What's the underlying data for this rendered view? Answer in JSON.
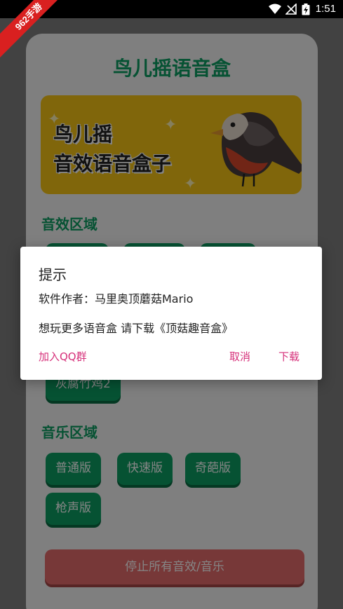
{
  "status_bar": {
    "time": "1:51"
  },
  "watermark": "962手游",
  "app": {
    "title": "鸟儿摇语音盒",
    "banner": {
      "line1": "鸟儿摇",
      "line2": "音效语音盒子"
    },
    "sfx_section": {
      "title": "音效区域",
      "buttons": [
        "",
        "",
        "",
        "灰腐竹鸡2"
      ]
    },
    "music_section": {
      "title": "音乐区域",
      "buttons": [
        "普通版",
        "快速版",
        "奇葩版",
        "枪声版"
      ]
    },
    "stop_button": "停止所有音效/音乐"
  },
  "dialog": {
    "title": "提示",
    "message_author": "软件作者：马里奥顶蘑菇Mario",
    "message_more": "想玩更多语音盒 请下载《顶菇趣音盒》",
    "join_group": "加入QQ群",
    "cancel": "取消",
    "download": "下载"
  },
  "colors": {
    "accent_green": "#0d9d63",
    "banner_yellow": "#f5c316",
    "stop_red": "#e46b6b",
    "dialog_action": "#d6307a"
  }
}
